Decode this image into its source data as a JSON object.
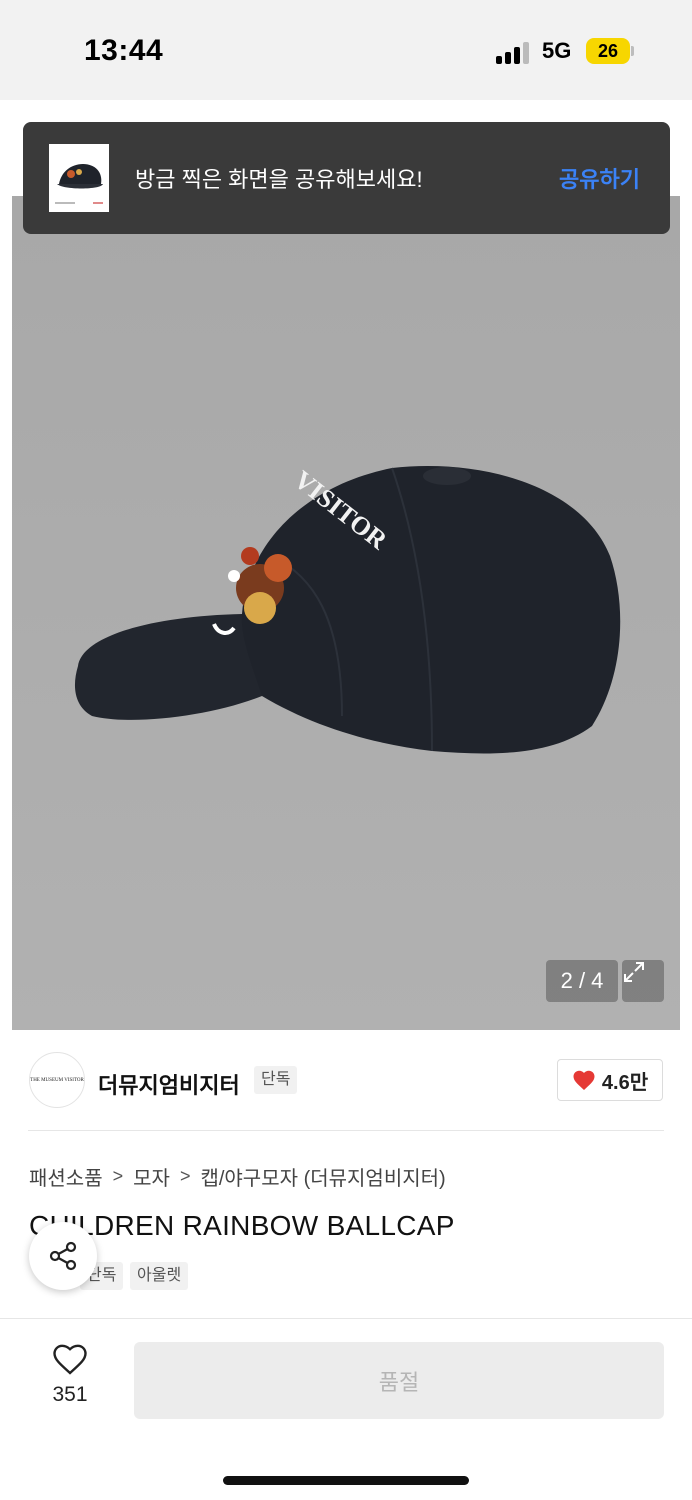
{
  "status_bar": {
    "time": "13:44",
    "network": "5G",
    "battery": "26"
  },
  "toast": {
    "message": "방금 찍은 화면을 공유해보세요!",
    "action": "공유하기"
  },
  "gallery": {
    "pager": "2 / 4",
    "cap_text": "VISITOR"
  },
  "brand": {
    "logo_text": "THE MUSEUM VISITOR",
    "name": "더뮤지엄비지터",
    "badge": "단독",
    "likes": "4.6만"
  },
  "breadcrumb": [
    "패션소품",
    "모자",
    "캡/야구모자 (더뮤지엄비지터)"
  ],
  "product": {
    "title": "CHILDREN RAINBOW BALLCAP",
    "tags": [
      "단독",
      "아울렛"
    ]
  },
  "bottom_bar": {
    "wish_count": "351",
    "buy_label": "품절"
  },
  "colors": {
    "accent": "#3b82f6",
    "heart": "#e53935",
    "cap": "#1f232b"
  },
  "icons": [
    "share-icon",
    "heart-icon",
    "heart-outline-icon",
    "expand-icon"
  ]
}
